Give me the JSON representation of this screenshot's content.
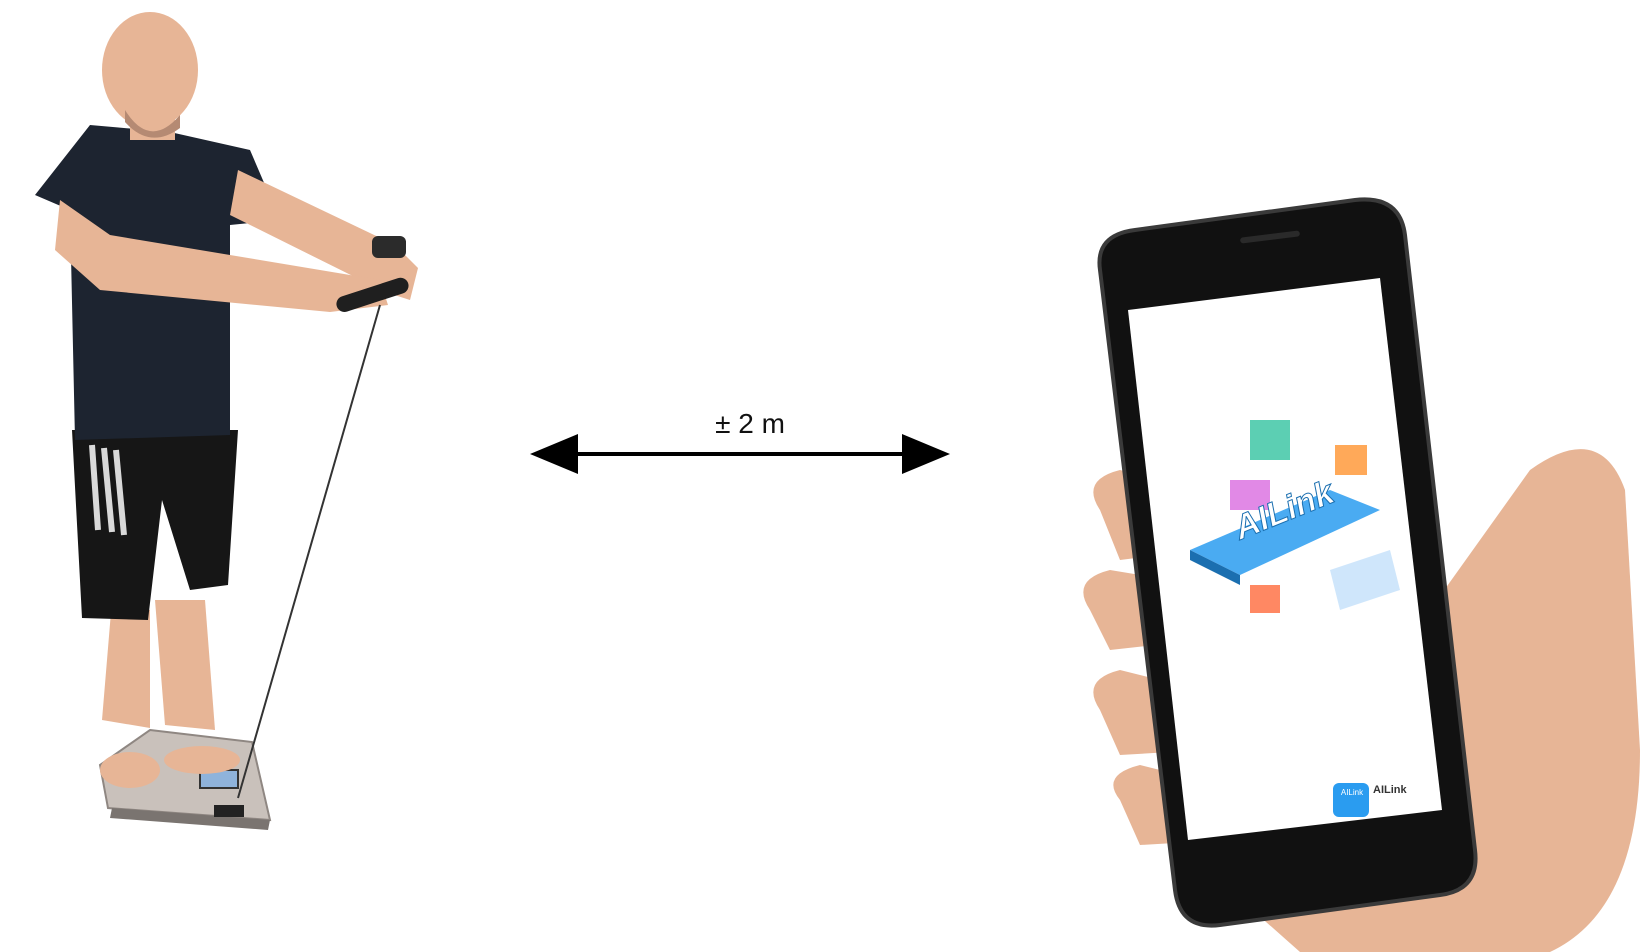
{
  "distance": {
    "label": "± 2 m"
  },
  "app": {
    "splash_title": "AILink",
    "brand_name": "AILink",
    "logo_text": "AILink"
  },
  "colors": {
    "shirt": "#1d2430",
    "shorts": "#161616",
    "skin": "#e7b596",
    "scale": "#c9c1bb",
    "scale_display": "#8fb3db",
    "phone_body": "#111111",
    "app_accent": "#2a9cf0",
    "arrow": "#000000"
  }
}
